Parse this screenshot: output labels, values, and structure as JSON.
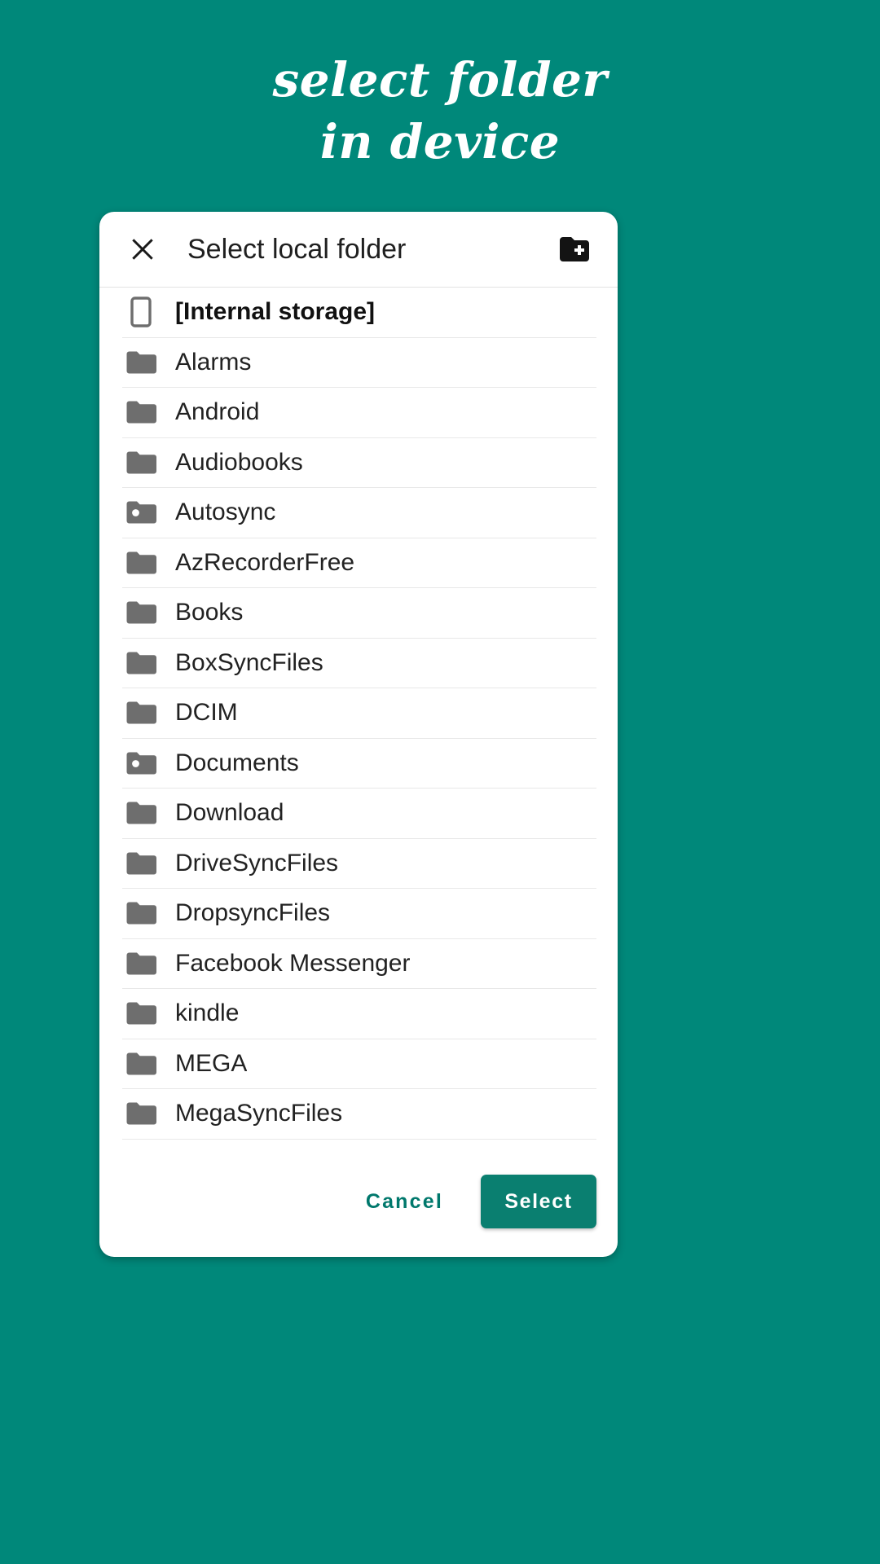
{
  "promo": {
    "line1": "select folder",
    "line2": "in device"
  },
  "colors": {
    "background_teal": "#00887a",
    "accent_teal": "#0a7f70",
    "cancel_text": "#00786c",
    "folder_icon_gray": "#6e6e6e",
    "card_white": "#ffffff",
    "divider": "#e8e8e8"
  },
  "dialog": {
    "title": "Select local folder",
    "close_icon": "close-icon",
    "new_folder_icon": "create-new-folder-icon",
    "rows": [
      {
        "label": "[Internal storage]",
        "icon": "phone-device-icon",
        "type": "storage"
      },
      {
        "label": "Alarms",
        "icon": "folder-icon",
        "type": "folder"
      },
      {
        "label": "Android",
        "icon": "folder-icon",
        "type": "folder"
      },
      {
        "label": "Audiobooks",
        "icon": "folder-icon",
        "type": "folder"
      },
      {
        "label": "Autosync",
        "icon": "folder-with-dot-icon",
        "type": "folder"
      },
      {
        "label": "AzRecorderFree",
        "icon": "folder-icon",
        "type": "folder"
      },
      {
        "label": "Books",
        "icon": "folder-icon",
        "type": "folder"
      },
      {
        "label": "BoxSyncFiles",
        "icon": "folder-icon",
        "type": "folder"
      },
      {
        "label": "DCIM",
        "icon": "folder-icon",
        "type": "folder"
      },
      {
        "label": "Documents",
        "icon": "folder-with-dot-icon",
        "type": "folder"
      },
      {
        "label": "Download",
        "icon": "folder-icon",
        "type": "folder"
      },
      {
        "label": "DriveSyncFiles",
        "icon": "folder-icon",
        "type": "folder"
      },
      {
        "label": "DropsyncFiles",
        "icon": "folder-icon",
        "type": "folder"
      },
      {
        "label": "Facebook Messenger",
        "icon": "folder-icon",
        "type": "folder"
      },
      {
        "label": "kindle",
        "icon": "folder-icon",
        "type": "folder"
      },
      {
        "label": "MEGA",
        "icon": "folder-icon",
        "type": "folder"
      },
      {
        "label": "MegaSyncFiles",
        "icon": "folder-icon",
        "type": "folder"
      }
    ],
    "footer": {
      "cancel_label": "Cancel",
      "select_label": "Select"
    }
  }
}
